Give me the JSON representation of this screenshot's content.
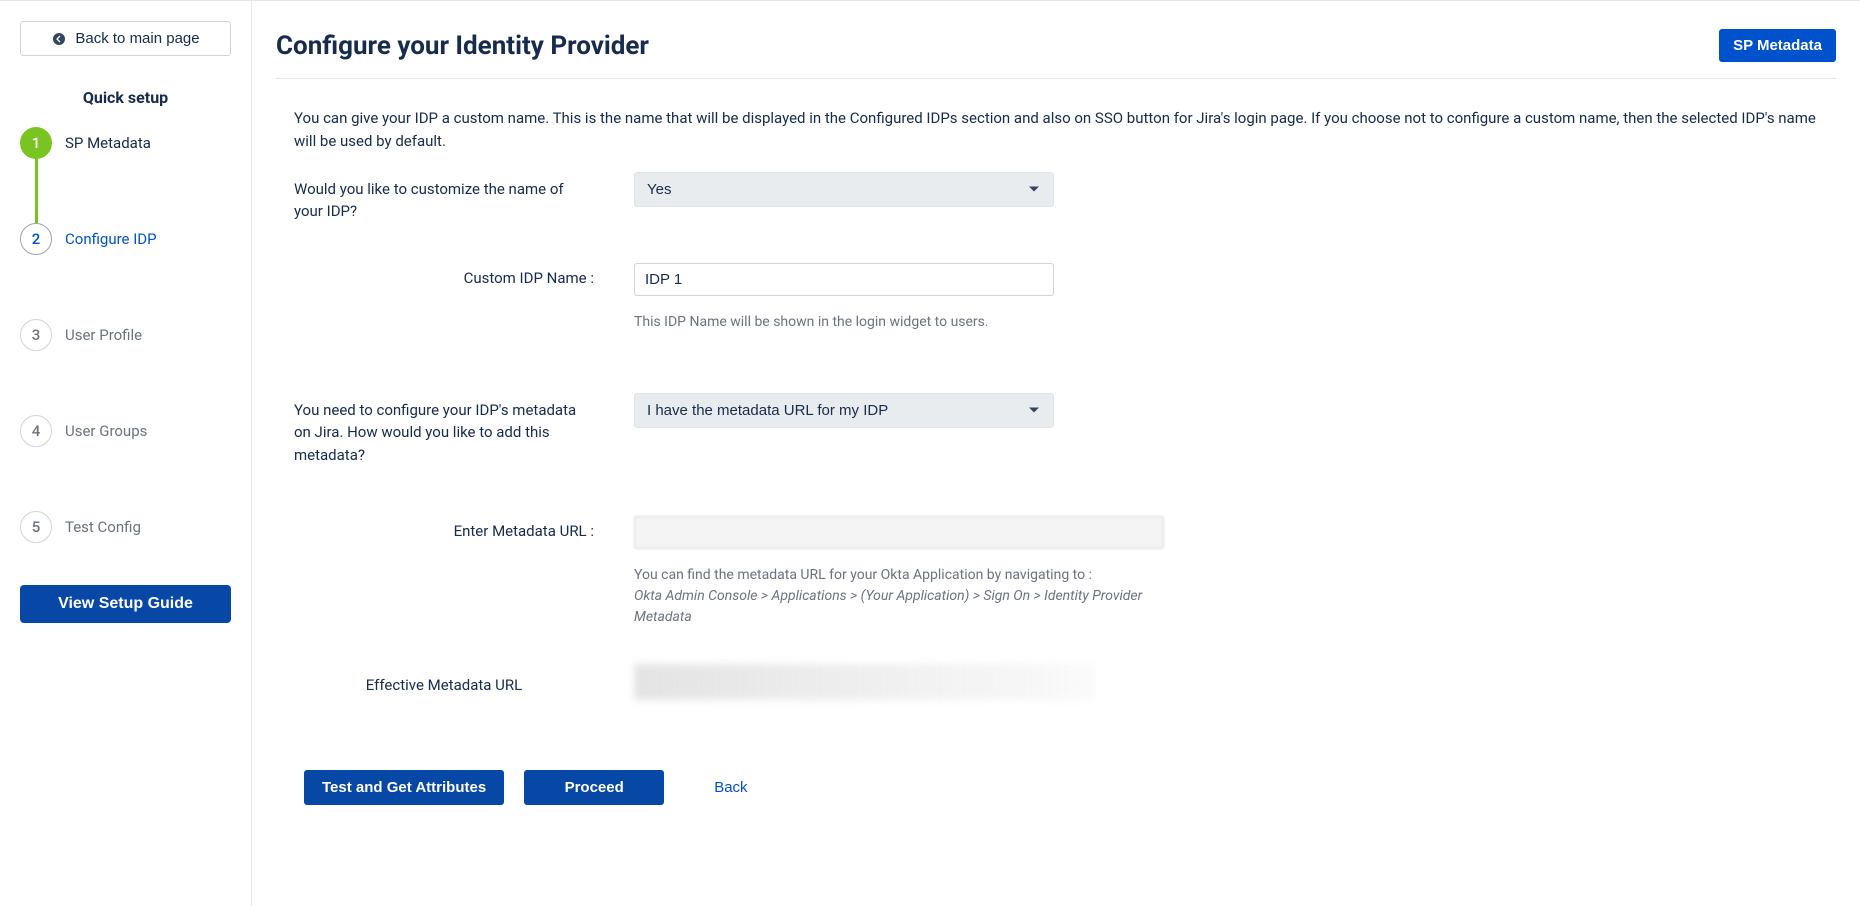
{
  "sidebar": {
    "back_label": "Back to main page",
    "quick_setup_title": "Quick setup",
    "steps": [
      {
        "num": "1",
        "label": "SP Metadata",
        "state": "completed"
      },
      {
        "num": "2",
        "label": "Configure IDP",
        "state": "active"
      },
      {
        "num": "3",
        "label": "User Profile",
        "state": "pending"
      },
      {
        "num": "4",
        "label": "User Groups",
        "state": "pending"
      },
      {
        "num": "5",
        "label": "Test Config",
        "state": "pending"
      }
    ],
    "setup_guide_label": "View Setup Guide"
  },
  "header": {
    "page_title": "Configure your Identity Provider",
    "sp_metadata_btn": "SP Metadata"
  },
  "intro": "You can give your IDP a custom name. This is the name that will be displayed in the Configured IDPs section and also on SSO button for Jira's login page. If you choose not to configure a custom name, then the selected IDP's name will be used by default.",
  "form": {
    "customize_question": "Would you like to customize the name of your IDP?",
    "customize_value": "Yes",
    "custom_idp_label": "Custom IDP Name :",
    "custom_idp_value": "IDP 1",
    "custom_idp_helper": "This IDP Name will be shown in the login widget to users.",
    "metadata_question": "You need to configure your IDP's metadata on Jira. How would you like to add this metadata?",
    "metadata_value": "I have the metadata URL for my IDP",
    "metadata_url_label": "Enter Metadata URL :",
    "metadata_url_value": "",
    "metadata_url_helper_intro": "You can find the metadata URL for your Okta Application by navigating to :",
    "metadata_url_helper_path": "Okta Admin Console > Applications > (Your Application) > Sign On > Identity Provider Metadata",
    "effective_url_label": "Effective Metadata URL"
  },
  "actions": {
    "test_label": "Test and Get Attributes",
    "proceed_label": "Proceed",
    "back_label": "Back"
  }
}
